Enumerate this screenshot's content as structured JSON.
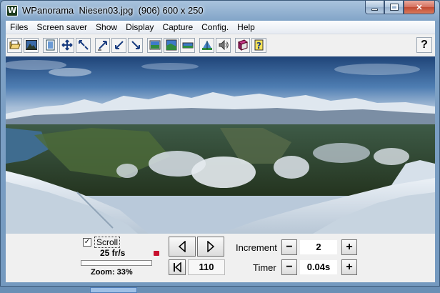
{
  "window": {
    "title": "WPanorama  Niesen03.jpg  (906) 600 x 250"
  },
  "menu": [
    "Files",
    "Screen saver",
    "Show",
    "Display",
    "Capture",
    "Config.",
    "Help"
  ],
  "toolbar": {
    "buttons": [
      "open-file-icon",
      "image-icon",
      "fit-window-icon",
      "expand-icon",
      "shrink-icon",
      "arrow-up-right-icon",
      "arrow-down-left-icon",
      "arrow-down-right-icon",
      "panorama-blue-icon",
      "panorama-green-icon",
      "panorama-strip-icon",
      "landscape-icon",
      "sound-icon",
      "book-icon",
      "help-book-icon"
    ],
    "help_label": "?"
  },
  "controls": {
    "scroll_checked": true,
    "scroll_label": "Scroll",
    "fps": "25 fr/s",
    "zoom_label": "Zoom: 33%",
    "zoom_fraction": 0.33,
    "position": "110",
    "increment_label": "Increment",
    "increment_value": "2",
    "timer_label": "Timer",
    "timer_value": "0.04s",
    "minus": "−",
    "plus": "+",
    "check_mark": "✓"
  }
}
